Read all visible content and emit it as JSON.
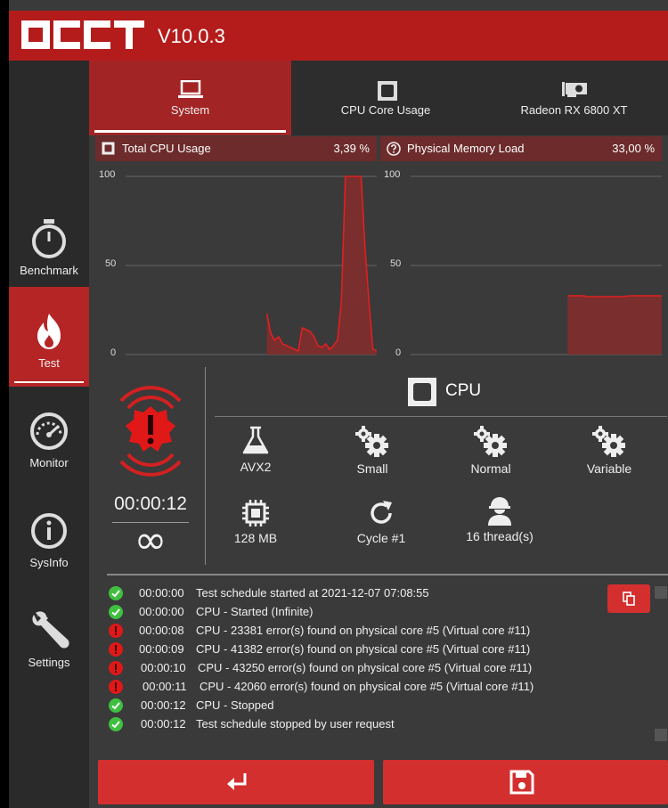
{
  "app": {
    "logo_text": "OCCT",
    "version": "V10.0.3"
  },
  "sidebar": {
    "items": [
      {
        "label": "Benchmark",
        "icon": "stopwatch-icon"
      },
      {
        "label": "Test",
        "icon": "flame-icon"
      },
      {
        "label": "Monitor",
        "icon": "gauge-icon"
      },
      {
        "label": "SysInfo",
        "icon": "info-icon"
      },
      {
        "label": "Settings",
        "icon": "wrench-icon"
      }
    ],
    "active": "Test"
  },
  "tabs": [
    {
      "label": "System",
      "icon": "laptop-icon"
    },
    {
      "label": "CPU Core Usage",
      "icon": "chip-icon"
    },
    {
      "label": "Radeon RX 6800 XT",
      "icon": "gpu-icon"
    }
  ],
  "panels": {
    "cpu": {
      "title": "Total CPU Usage",
      "value": "3,39 %"
    },
    "mem": {
      "title": "Physical Memory Load",
      "value": "33,00 %"
    }
  },
  "chart_data": [
    {
      "type": "area",
      "title": "Total CPU Usage",
      "ylim": [
        0,
        100
      ],
      "yticks": [
        "100",
        "50",
        "0"
      ],
      "grid": true,
      "x": [
        0,
        1,
        2,
        3,
        4,
        5,
        6,
        7,
        8,
        9,
        10,
        11,
        12,
        13,
        14,
        15,
        16,
        17,
        18,
        19,
        20,
        21,
        22,
        23,
        24,
        25,
        26,
        27,
        28,
        29,
        30,
        31,
        32,
        33,
        34,
        35,
        36,
        37,
        38,
        39,
        40,
        41,
        42,
        43,
        44,
        45,
        46,
        47,
        48,
        49,
        50,
        51,
        52,
        53,
        54,
        55,
        56,
        57,
        58,
        59,
        60,
        61,
        62,
        63,
        64
      ],
      "values": [
        null,
        null,
        null,
        null,
        null,
        null,
        null,
        null,
        null,
        null,
        null,
        null,
        null,
        null,
        null,
        null,
        null,
        null,
        null,
        null,
        null,
        null,
        null,
        null,
        null,
        null,
        null,
        null,
        null,
        null,
        null,
        null,
        null,
        null,
        null,
        null,
        23,
        12,
        8,
        10,
        6,
        5,
        4,
        3,
        2,
        15,
        14,
        13,
        10,
        5,
        4,
        6,
        3,
        5,
        8,
        30,
        100,
        100,
        100,
        100,
        100,
        60,
        30,
        3,
        2
      ]
    },
    {
      "type": "area",
      "title": "Physical Memory Load",
      "ylim": [
        0,
        100
      ],
      "yticks": [
        "100",
        "50",
        "0"
      ],
      "grid": true,
      "x": [
        0,
        1,
        2,
        3,
        4,
        5,
        6,
        7,
        8,
        9,
        10,
        11,
        12,
        13,
        14,
        15,
        16,
        17,
        18,
        19,
        20,
        21,
        22,
        23,
        24,
        25,
        26,
        27,
        28,
        29,
        30,
        31,
        32,
        33,
        34,
        35,
        36,
        37,
        38,
        39,
        40,
        41,
        42,
        43,
        44,
        45,
        46,
        47,
        48,
        49,
        50,
        51,
        52,
        53,
        54,
        55,
        56,
        57,
        58,
        59,
        60,
        61,
        62,
        63,
        64
      ],
      "values": [
        null,
        null,
        null,
        null,
        null,
        null,
        null,
        null,
        null,
        null,
        null,
        null,
        null,
        null,
        null,
        null,
        null,
        null,
        null,
        null,
        null,
        null,
        null,
        null,
        null,
        null,
        null,
        null,
        null,
        null,
        null,
        null,
        null,
        null,
        null,
        null,
        null,
        null,
        null,
        null,
        33,
        33,
        33,
        33,
        33,
        32.5,
        32.5,
        32.5,
        32.5,
        32.5,
        32.5,
        32.5,
        32.5,
        32.5,
        32.5,
        32.8,
        33,
        33,
        33,
        33,
        33,
        33,
        33,
        33,
        33
      ]
    }
  ],
  "test": {
    "time": "00:00:12",
    "duration": "∞",
    "device_name": "CPU",
    "params": [
      {
        "label": "AVX2",
        "icon": "flask-icon"
      },
      {
        "label": "Small",
        "icon": "gears-icon"
      },
      {
        "label": "Normal",
        "icon": "gears-icon"
      },
      {
        "label": "Variable",
        "icon": "gears-icon"
      },
      {
        "label": "128 MB",
        "icon": "memory-chip-icon"
      },
      {
        "label": "Cycle #1",
        "icon": "refresh-icon"
      },
      {
        "label": "16 thread(s)",
        "icon": "worker-icon"
      }
    ]
  },
  "log": [
    {
      "status": "ok",
      "time": "00:00:00",
      "message": "Test schedule started at 2021-12-07 07:08:55"
    },
    {
      "status": "ok",
      "time": "00:00:00",
      "message": "CPU - Started (Infinite)"
    },
    {
      "status": "error",
      "time": "00:00:08",
      "message": "CPU - 23381 error(s) found on physical core #5 (Virtual core #11)"
    },
    {
      "status": "error",
      "time": "00:00:09",
      "message": "CPU - 41382 error(s) found on physical core #5 (Virtual core #11)"
    },
    {
      "status": "error",
      "time": "00:00:10",
      "message": "CPU - 43250 error(s) found on physical core #5 (Virtual core #11)"
    },
    {
      "status": "error",
      "time": "00:00:11",
      "message": "CPU - 42060 error(s) found on physical core #5 (Virtual core #11)"
    },
    {
      "status": "ok",
      "time": "00:00:12",
      "message": "CPU - Stopped"
    },
    {
      "status": "ok",
      "time": "00:00:12",
      "message": "Test schedule stopped by user request"
    }
  ],
  "colors": {
    "accent": "#b41c1c",
    "button": "#d32f2f",
    "ok": "#3fbf3f",
    "error": "#e01818"
  }
}
